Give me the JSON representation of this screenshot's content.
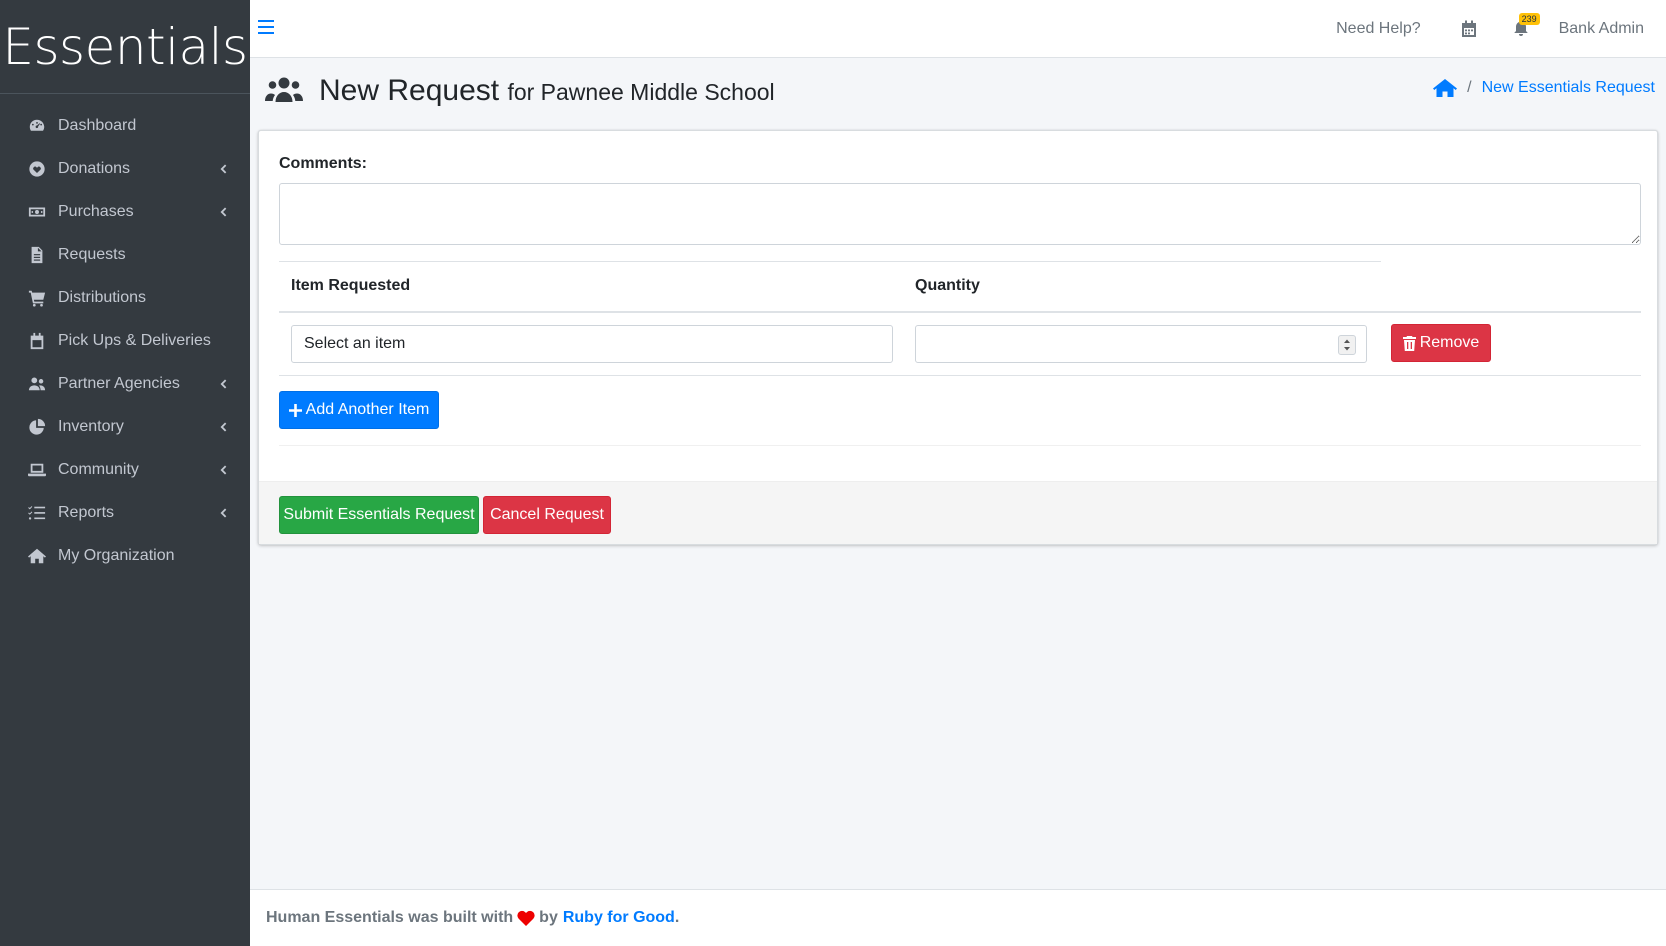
{
  "brand": {
    "name": "Essentials"
  },
  "sidebar": {
    "items": [
      {
        "label": "Dashboard",
        "icon": "dashboard-icon",
        "has_submenu": false
      },
      {
        "label": "Donations",
        "icon": "heart-circle-icon",
        "has_submenu": true
      },
      {
        "label": "Purchases",
        "icon": "money-bill-icon",
        "has_submenu": true
      },
      {
        "label": "Requests",
        "icon": "file-icon",
        "has_submenu": false
      },
      {
        "label": "Distributions",
        "icon": "cart-icon",
        "has_submenu": false
      },
      {
        "label": "Pick Ups & Deliveries",
        "icon": "calendar-icon",
        "has_submenu": false
      },
      {
        "label": "Partner Agencies",
        "icon": "users-icon",
        "has_submenu": true
      },
      {
        "label": "Inventory",
        "icon": "pie-chart-icon",
        "has_submenu": true
      },
      {
        "label": "Community",
        "icon": "laptop-icon",
        "has_submenu": true
      },
      {
        "label": "Reports",
        "icon": "list-check-icon",
        "has_submenu": true
      },
      {
        "label": "My Organization",
        "icon": "home-icon",
        "has_submenu": false
      }
    ]
  },
  "topbar": {
    "help_label": "Need Help?",
    "notification_count": "239",
    "user_name": "Bank Admin"
  },
  "header": {
    "title": "New Request",
    "subtitle": "for Pawnee Middle School",
    "breadcrumb_current": "New Essentials Request"
  },
  "form": {
    "comments_label": "Comments:",
    "comments_value": "",
    "col_item": "Item Requested",
    "col_quantity": "Quantity",
    "item_select_value": "Select an item",
    "quantity_value": "",
    "remove_label": "Remove",
    "add_item_label": "Add Another Item",
    "submit_label": "Submit Essentials Request",
    "cancel_label": "Cancel Request"
  },
  "footer": {
    "text_before": "Human Essentials was built with",
    "text_by": "by",
    "link_text": "Ruby for Good",
    "period": "."
  },
  "colors": {
    "sidebar_bg": "#343a40",
    "primary": "#007bff",
    "success": "#28a745",
    "danger": "#dc3545",
    "badge": "#ffc107"
  }
}
